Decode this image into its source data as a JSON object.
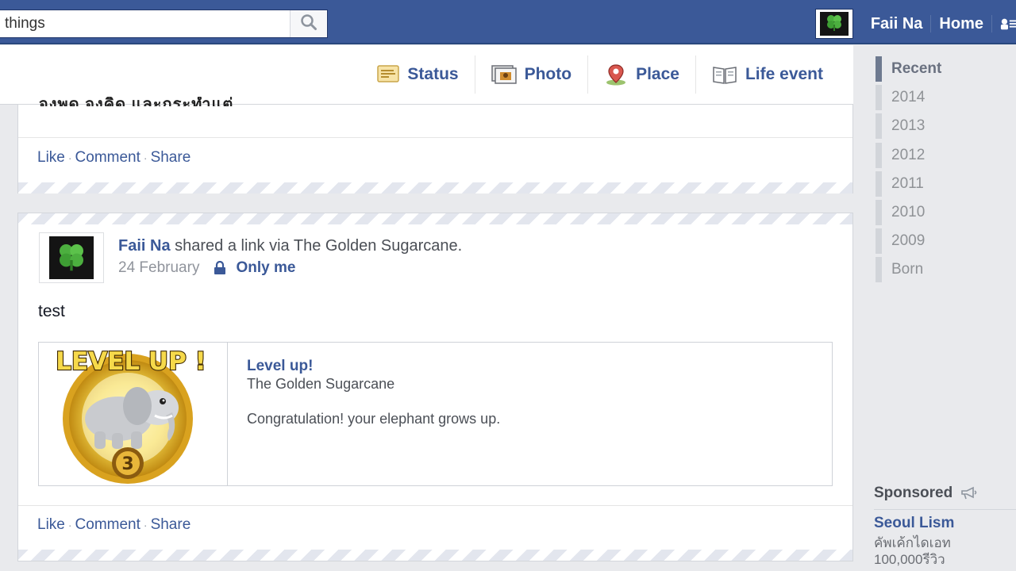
{
  "search": {
    "value": "things",
    "icon": "search-icon"
  },
  "nav": {
    "user_name": "Faii Na",
    "home_label": "Home",
    "avatar_icon": "clover-icon",
    "friends_icon": "friend-requests-icon"
  },
  "composer": {
    "items": [
      {
        "label": "Status",
        "icon": "status-icon"
      },
      {
        "label": "Photo",
        "icon": "photo-icon"
      },
      {
        "label": "Place",
        "icon": "place-pin-icon"
      },
      {
        "label": "Life event",
        "icon": "life-event-book-icon"
      }
    ]
  },
  "story1": {
    "cut_text": "จงพูด จงคิด และกระทำแต่",
    "actions": {
      "like": "Like",
      "comment": "Comment",
      "share": "Share"
    }
  },
  "story2": {
    "author": "Faii Na",
    "verb": "shared a link via The Golden Sugarcane.",
    "date": "24 February",
    "privacy": "Only me",
    "text": "test",
    "attachment": {
      "title": "Level up!",
      "source": "The Golden Sugarcane",
      "description": "Congratulation! your elephant grows up.",
      "image_banner": "LEVEL UP !",
      "image_level": "3"
    },
    "actions": {
      "like": "Like",
      "comment": "Comment",
      "share": "Share"
    }
  },
  "timeline": {
    "years": [
      "Recent",
      "2014",
      "2013",
      "2012",
      "2011",
      "2010",
      "2009",
      "Born"
    ],
    "active": "Recent"
  },
  "sponsored": {
    "label": "Sponsored",
    "icon": "megaphone-icon",
    "ad_title": "Seoul Lism",
    "ad_lines": [
      "คัพเค้กไดเอท",
      "100,000รีวิว"
    ]
  },
  "colors": {
    "brand_blue": "#3b5998",
    "link_blue": "#3b5998",
    "page_bg": "#e9eaed"
  }
}
